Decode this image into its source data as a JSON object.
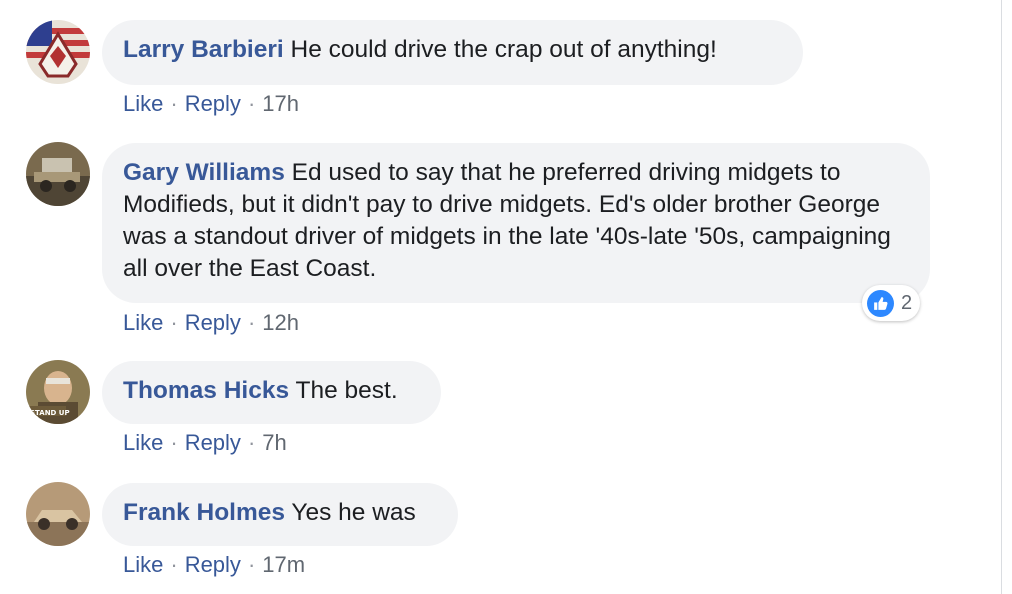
{
  "actions": {
    "like": "Like",
    "reply": "Reply",
    "dot": "·"
  },
  "comments": [
    {
      "author": "Larry Barbieri",
      "text": "He could drive the crap out of anything!",
      "time": "17h"
    },
    {
      "author": "Gary Williams",
      "text": "Ed used to say that he preferred driving midgets to Modifieds, but it didn't pay to drive midgets. Ed's older brother George was a standout driver of midgets in the late '40s-late '50s, campaigning all over the East Coast.",
      "time": "12h",
      "reaction": {
        "icon": "like-thumb-icon",
        "count": "2"
      }
    },
    {
      "author": "Thomas Hicks",
      "text": "The best.",
      "time": "7h",
      "avatar_text": "STAND UP"
    },
    {
      "author": "Frank Holmes",
      "text": "Yes he was",
      "time": "17m"
    }
  ],
  "colors": {
    "name": "#385898",
    "bubble": "#f2f3f5",
    "like": "#2d88ff"
  }
}
